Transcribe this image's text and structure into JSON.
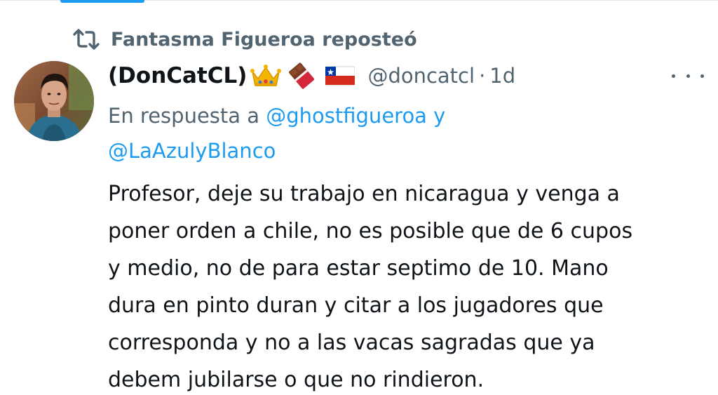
{
  "repost": {
    "icon": "repost-icon",
    "text": "Fantasma Figueroa reposteó"
  },
  "author": {
    "avatar": "profile-photo",
    "display_name": "(DonCatCL)",
    "name_emojis": [
      "crown-emoji",
      "chocolate-bar-emoji",
      "chile-flag-emoji"
    ],
    "handle": "@doncatcl",
    "separator": "·",
    "time": "1d"
  },
  "more_menu": {
    "icon": "more-horizontal-icon"
  },
  "reply": {
    "prefix": "En respuesta a ",
    "mention_1": "@ghostfigueroa",
    "joiner": " y",
    "mention_2": "@LaAzulyBlanco"
  },
  "tweet": {
    "lines": [
      "Profesor, deje su trabajo en nicaragua y venga a",
      "poner orden a chile, no es posible que de 6 cupos",
      "y medio, no de para estar septimo de 10. Mano",
      "dura en pinto duran y citar a los jugadores que",
      "corresponda y no a las vacas sagradas que ya",
      "debem jubilarse o que no rindieron."
    ]
  },
  "colors": {
    "accent": "#1d9bf0",
    "secondary_text": "#536471",
    "primary_text": "#0f1419"
  }
}
